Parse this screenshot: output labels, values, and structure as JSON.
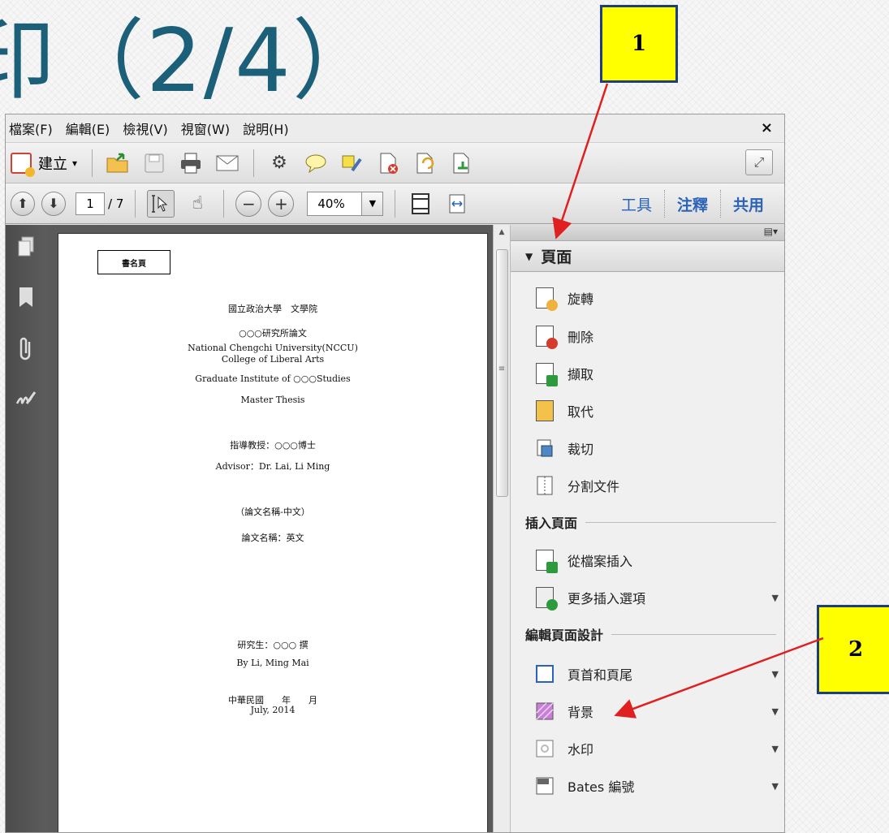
{
  "slide": {
    "title": "印（2/4）"
  },
  "callouts": {
    "one": "1",
    "two": "2"
  },
  "menu": {
    "items": [
      "檔案(F)",
      "編輯(E)",
      "檢視(V)",
      "視窗(W)",
      "說明(H)"
    ],
    "close": "×"
  },
  "toolbar": {
    "create_label": "建立",
    "create_caret": "▾"
  },
  "nav": {
    "page_current": "1",
    "page_total": "/ 7",
    "zoom": "40%",
    "tabs": {
      "tools": "工具",
      "comment": "注釋",
      "share": "共用"
    }
  },
  "document": {
    "label_box": "書名頁",
    "lines": [
      "國立政治大學　文學院",
      "○○○研究所論文",
      "National Chengchi University(NCCU)",
      "College of Liberal Arts",
      "Graduate Institute of ○○○Studies",
      "Master Thesis",
      "指導教授：○○○博士",
      "Advisor：Dr. Lai, Li Ming",
      "（論文名稱-中文）",
      "論文名稱：英文",
      "研究生：○○○ 撰",
      "By Li, Ming Mai",
      "中華民國　　年　　月",
      "July, 2014"
    ]
  },
  "panel": {
    "header": "頁面",
    "pages_items": [
      "旋轉",
      "刪除",
      "擷取",
      "取代",
      "裁切",
      "分割文件"
    ],
    "insert_section": "插入頁面",
    "insert_items": [
      "從檔案插入",
      "更多插入選項"
    ],
    "design_section": "編輯頁面設計",
    "design_items": [
      "頁首和頁尾",
      "背景",
      "水印",
      "Bates 編號"
    ]
  },
  "colors": {
    "title": "#1c5f78",
    "callout_fill": "#ffff00",
    "callout_border": "#1f3f7a",
    "arrow": "#e02020",
    "tab_link": "#2a63b8"
  }
}
